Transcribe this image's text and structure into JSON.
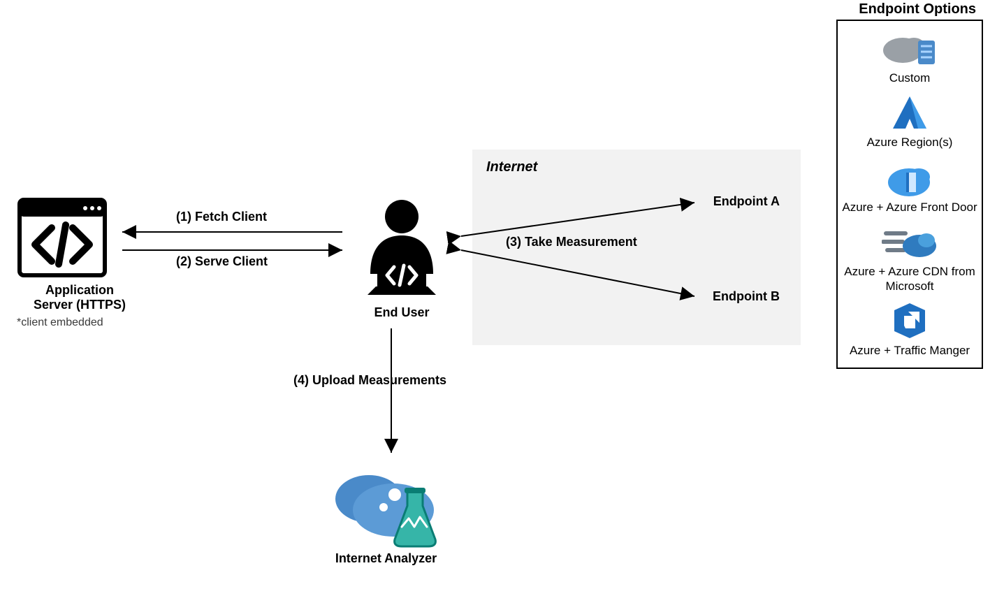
{
  "nodes": {
    "app_server": {
      "title_line1": "Application",
      "title_line2": "Server (HTTPS)",
      "note": "*client embedded"
    },
    "end_user": {
      "title": "End User"
    },
    "internet_analyzer": {
      "title": "Internet Analyzer"
    }
  },
  "flows": {
    "fetch": "(1) Fetch Client",
    "serve": "(2) Serve Client",
    "measure": "(3) Take Measurement",
    "upload": "(4) Upload Measurements"
  },
  "internet_box": {
    "title": "Internet",
    "endpoint_a": "Endpoint A",
    "endpoint_b": "Endpoint B"
  },
  "options": {
    "heading": "Endpoint Options",
    "items": [
      {
        "label": "Custom"
      },
      {
        "label": "Azure Region(s)"
      },
      {
        "label": "Azure + Azure Front Door"
      },
      {
        "label": "Azure + Azure CDN from Microsoft"
      },
      {
        "label": "Azure + Traffic Manger"
      }
    ]
  }
}
